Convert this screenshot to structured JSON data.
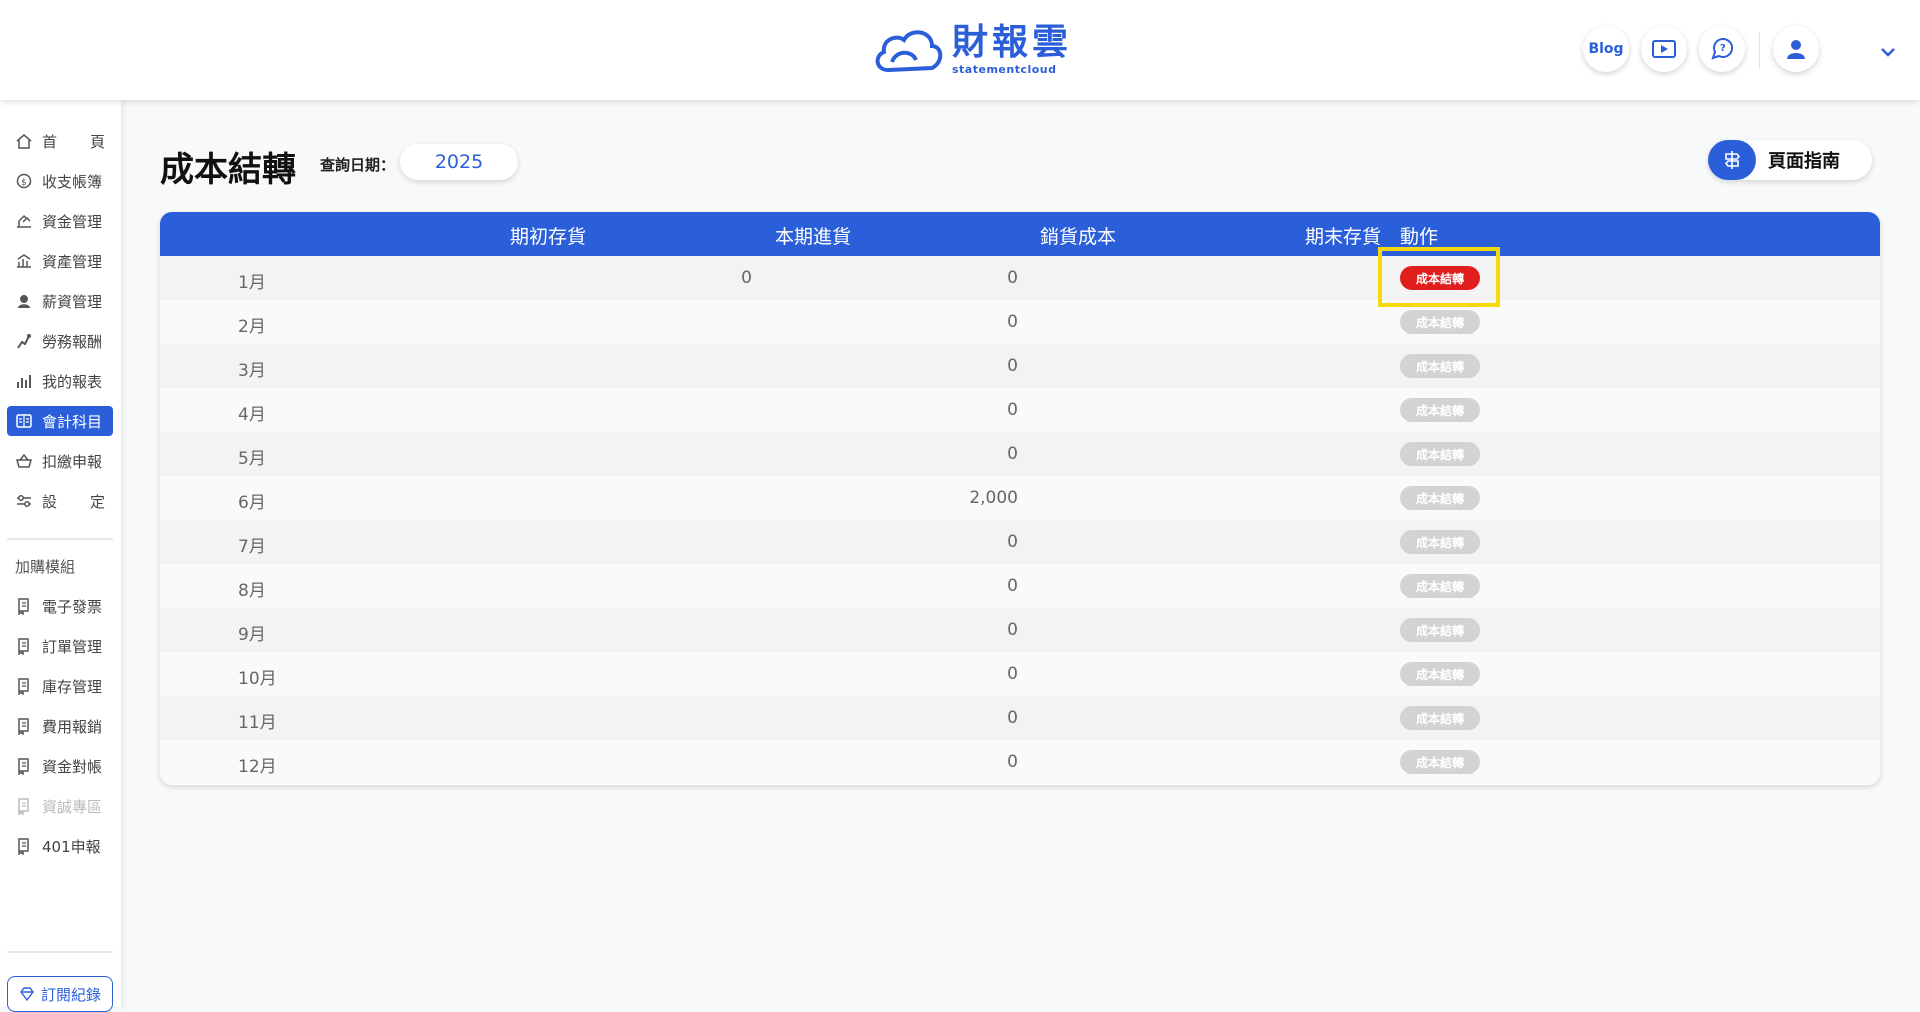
{
  "header": {
    "logo_cn": "財報雲",
    "logo_en": "statementcloud",
    "blog_label": "Blog"
  },
  "sidebar": {
    "items": [
      {
        "label_a": "首",
        "label_b": "頁",
        "icon": "home-icon"
      },
      {
        "label": "收支帳簿",
        "icon": "money-icon"
      },
      {
        "label": "資金管理",
        "icon": "fund-icon"
      },
      {
        "label": "資產管理",
        "icon": "asset-icon"
      },
      {
        "label": "薪資管理",
        "icon": "salary-icon"
      },
      {
        "label": "勞務報酬",
        "icon": "labor-icon"
      },
      {
        "label": "我的報表",
        "icon": "report-icon"
      },
      {
        "label": "會計科目",
        "icon": "accounts-icon"
      },
      {
        "label": "扣繳申報",
        "icon": "withholding-icon"
      },
      {
        "label_a": "設",
        "label_b": "定",
        "icon": "settings-icon"
      }
    ],
    "addon_heading": "加購模組",
    "addons": [
      {
        "label": "電子發票"
      },
      {
        "label": "訂單管理"
      },
      {
        "label": "庫存管理"
      },
      {
        "label": "費用報銷"
      },
      {
        "label": "資金對帳"
      },
      {
        "label": "資誠專區"
      },
      {
        "label": "401申報"
      }
    ],
    "subscription_label": "訂閱紀錄"
  },
  "main": {
    "title": "成本結轉",
    "query_label": "查詢日期：",
    "year": "2025",
    "guide_label": "頁面指南"
  },
  "table": {
    "columns": [
      "期初存貨",
      "本期進貨",
      "銷貨成本",
      "期末存貨",
      "動作"
    ],
    "action_label": "成本結轉",
    "rows": [
      {
        "month": "1月",
        "opening": "0",
        "purchases": "0"
      },
      {
        "month": "2月",
        "opening": "",
        "purchases": "0"
      },
      {
        "month": "3月",
        "opening": "",
        "purchases": "0"
      },
      {
        "month": "4月",
        "opening": "",
        "purchases": "0"
      },
      {
        "month": "5月",
        "opening": "",
        "purchases": "0"
      },
      {
        "month": "6月",
        "opening": "",
        "purchases": "2,000"
      },
      {
        "month": "7月",
        "opening": "",
        "purchases": "0"
      },
      {
        "month": "8月",
        "opening": "",
        "purchases": "0"
      },
      {
        "month": "9月",
        "opening": "",
        "purchases": "0"
      },
      {
        "month": "10月",
        "opening": "",
        "purchases": "0"
      },
      {
        "month": "11月",
        "opening": "",
        "purchases": "0"
      },
      {
        "month": "12月",
        "opening": "",
        "purchases": "0"
      }
    ]
  },
  "colors": {
    "brand": "#2b5fd9",
    "action_active": "#e11d1d",
    "action_disabled": "#d3d3d3",
    "highlight": "#f5d90a"
  }
}
